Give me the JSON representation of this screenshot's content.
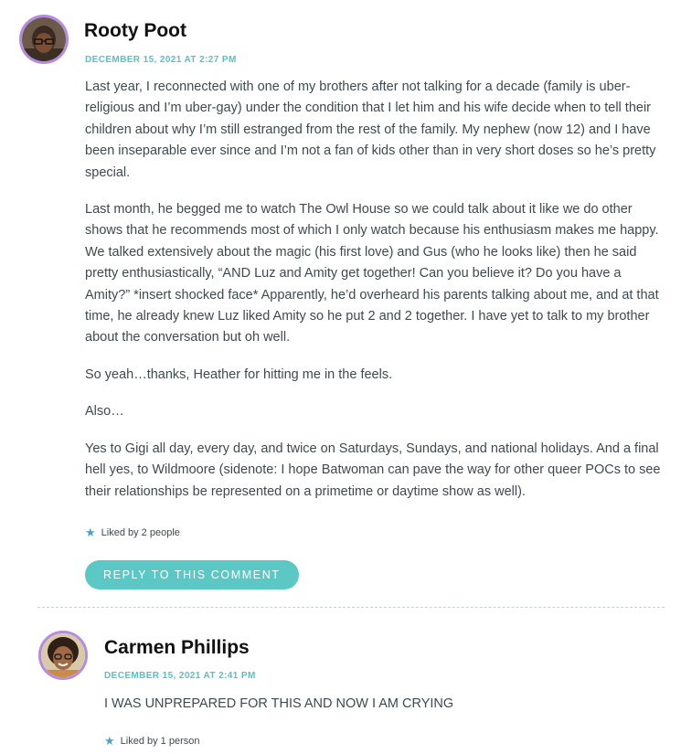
{
  "comments": [
    {
      "author": "Rooty Poot",
      "date": "DECEMBER 15, 2021 AT 2:27 PM",
      "paragraphs": [
        "Last year, I reconnected with one of my brothers after not talking for a decade (family is uber-religious and I’m uber-gay) under the condition that I let him and his wife decide when to tell their children about why I’m still estranged from the rest of the family. My nephew (now 12) and I have been inseparable ever since and I’m not a fan of kids other than in very short doses so he’s pretty special.",
        "Last month, he begged me to watch The Owl House so we could talk about it like we do other shows that he recommends most of which I only watch because his enthusiasm makes me happy. We talked extensively about the magic (his first love) and Gus (who he looks like) then he said pretty enthusiastically, “AND Luz and Amity get together! Can you believe it? Do you have a Amity?” *insert shocked face* Apparently, he’d overheard his parents talking about me, and at that time, he already knew Luz liked Amity so he put 2 and 2 together. I have yet to talk to my brother about the conversation but oh well.",
        "So yeah…thanks, Heather for hitting me in the feels.",
        "Also…",
        "Yes to Gigi all day, every day, and twice on Saturdays, Sundays, and national holidays. And a final hell yes, to Wildmoore (sidenote: I hope Batwoman can pave the way for other queer POCs to see their relationships be represented on a primetime or daytime show as well)."
      ],
      "likes": "Liked by 2 people",
      "reply_label": "REPLY TO THIS COMMENT"
    },
    {
      "author": "Carmen Phillips",
      "date": "DECEMBER 15, 2021 AT 2:41 PM",
      "paragraphs": [
        "I WAS UNPREPARED FOR THIS AND NOW I AM CRYING"
      ],
      "likes": "Liked by 1 person"
    }
  ],
  "colors": {
    "accent": "#5bc8c5",
    "date": "#5bc0c3",
    "avatar_ring": "#b48be0",
    "star": "#4da3c4",
    "text": "#3d4a4f",
    "author": "#111111"
  },
  "icons": {
    "like": "star-icon"
  }
}
